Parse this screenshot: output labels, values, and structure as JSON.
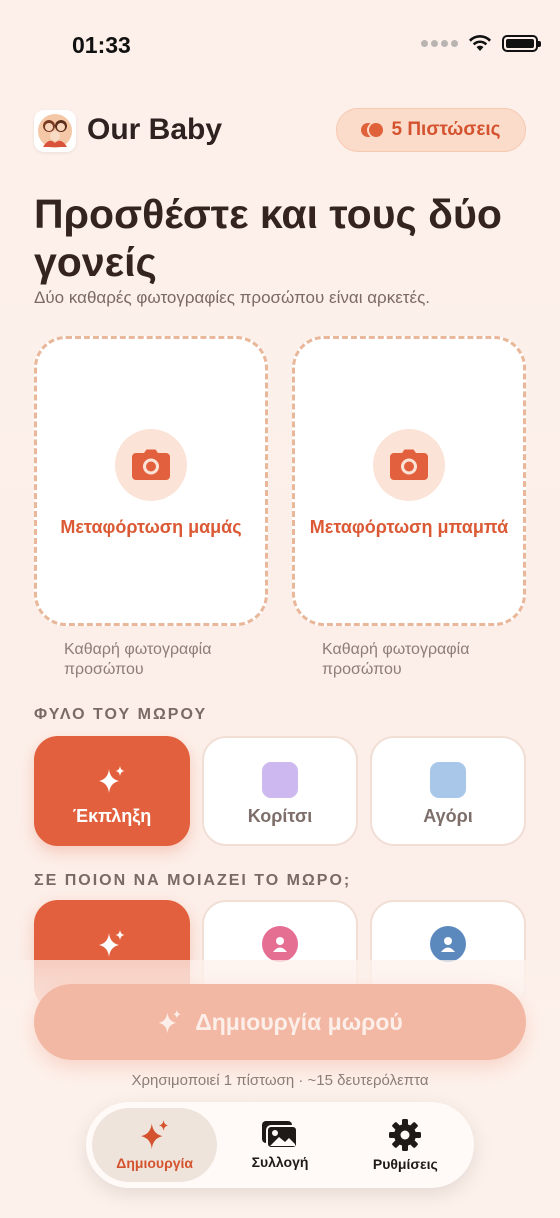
{
  "status_bar": {
    "time": "01:33"
  },
  "header": {
    "app_title": "Our Baby",
    "credits_label": "5 Πιστώσεις"
  },
  "intro": {
    "headline": "Προσθέστε και τους δύο γονείς",
    "subhead": "Δύο καθαρές φωτογραφίες προσώπου είναι αρκετές."
  },
  "uploads": {
    "mom_label": "Μεταφόρτωση μαμάς",
    "dad_label": "Μεταφόρτωση μπαμπά",
    "mom_hint": "Καθαρή φωτογραφία προσώπου",
    "dad_hint": "Καθαρή φωτογραφία προσώπου"
  },
  "gender": {
    "section_label": "ΦΥΛΟ ΤΟΥ ΜΩΡΟΥ",
    "options": [
      {
        "label": "Έκπληξη",
        "icon": "sparkles-icon",
        "selected": true
      },
      {
        "label": "Κορίτσι",
        "icon": "purple-swatch",
        "color": "#cdb8ef"
      },
      {
        "label": "Αγόρι",
        "icon": "blue-swatch",
        "color": "#a9c8e9"
      }
    ]
  },
  "resemblance": {
    "section_label": "ΣΕ ΠΟΙΟΝ ΝΑ ΜΟΙΑΖΕΙ ΤΟ ΜΩΡΟ;",
    "options": [
      {
        "icon": "sparkles-icon",
        "selected": true
      },
      {
        "icon": "person-icon",
        "color": "#e56e93"
      },
      {
        "icon": "person-icon",
        "color": "#5b88bd"
      }
    ]
  },
  "create": {
    "button_label": "Δημιουργία μωρού",
    "usage_note": "Χρησιμοποιεί 1 πίστωση · ~15 δευτερόλεπτα"
  },
  "tabs": [
    {
      "label": "Δημιουργία",
      "icon": "sparkles-icon",
      "active": true
    },
    {
      "label": "Συλλογή",
      "icon": "gallery-icon"
    },
    {
      "label": "Ρυθμίσεις",
      "icon": "gear-icon"
    }
  ],
  "colors": {
    "accent": "#e2603d",
    "background": "#fdf1eb"
  }
}
